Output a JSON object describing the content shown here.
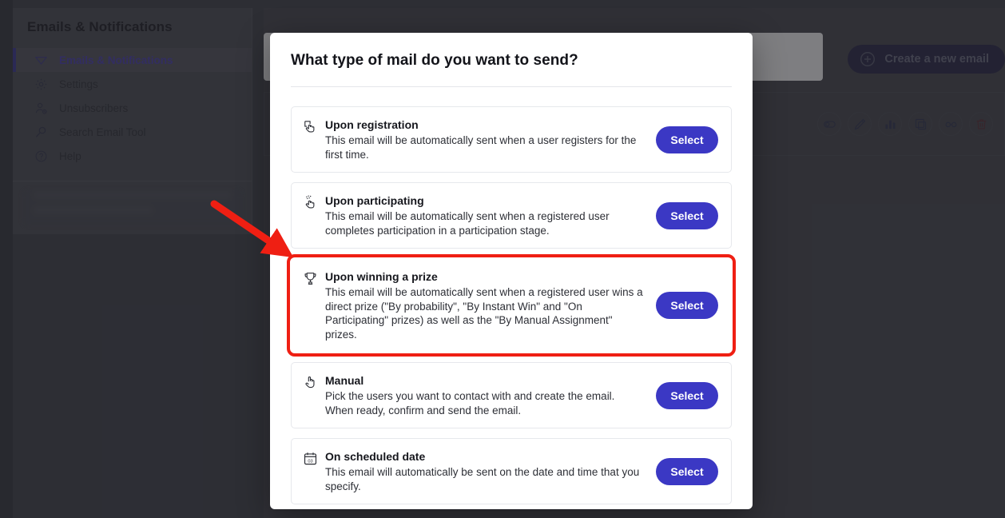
{
  "sidebar": {
    "title": "Emails & Notifications",
    "items": [
      {
        "label": "Emails & Notifications",
        "icon": "paper-plane-icon",
        "active": true
      },
      {
        "label": "Settings",
        "icon": "gear-icon",
        "active": false
      },
      {
        "label": "Unsubscribers",
        "icon": "user-remove-icon",
        "active": false
      },
      {
        "label": "Search Email Tool",
        "icon": "magnifier-icon",
        "active": false
      },
      {
        "label": "Help",
        "icon": "question-circle-icon",
        "active": false
      }
    ]
  },
  "content": {
    "create_button_label": "Create a new email",
    "create_button_icon": "plus-circle-icon",
    "row_actions": [
      {
        "icon": "toggle-icon",
        "name": "toggle-status"
      },
      {
        "icon": "pencil-icon",
        "name": "edit"
      },
      {
        "icon": "bar-chart-icon",
        "name": "statistics"
      },
      {
        "icon": "duplicate-icon",
        "name": "duplicate"
      },
      {
        "icon": "glasses-icon",
        "name": "preview"
      },
      {
        "icon": "trash-icon",
        "name": "delete"
      }
    ]
  },
  "modal": {
    "title": "What type of mail do you want to send?",
    "select_label": "Select",
    "options": [
      {
        "icon": "hand-pointer-box-icon",
        "name": "Upon registration",
        "description": "This email will be automatically sent when a user registers for the first time.",
        "highlighted": false
      },
      {
        "icon": "hand-tap-icon",
        "name": "Upon participating",
        "description": "This email will be automatically sent when a registered user completes participation in a participation stage.",
        "highlighted": false
      },
      {
        "icon": "trophy-icon",
        "name": "Upon winning a prize",
        "description": "This email will be automatically sent when a registered user wins a direct prize (\"By probability\", \"By Instant Win\" and \"On Participating\" prizes) as well as the \"By Manual Assignment\" prizes.",
        "highlighted": true
      },
      {
        "icon": "hand-icon",
        "name": "Manual",
        "description": "Pick the users you want to contact with and create the email. When ready, confirm and send the email.",
        "highlighted": false
      },
      {
        "icon": "calendar-icon",
        "name": "On scheduled date",
        "description": "This email will automatically be sent on the date and time that you specify.",
        "highlighted": false
      }
    ]
  },
  "annotation": {
    "arrow_color": "#ef1f13",
    "highlight_color": "#ef1f13"
  },
  "colors": {
    "accent": "#3b38c4",
    "sidebar_active_text": "#4a3fb5",
    "page_background": "#3f4149"
  }
}
